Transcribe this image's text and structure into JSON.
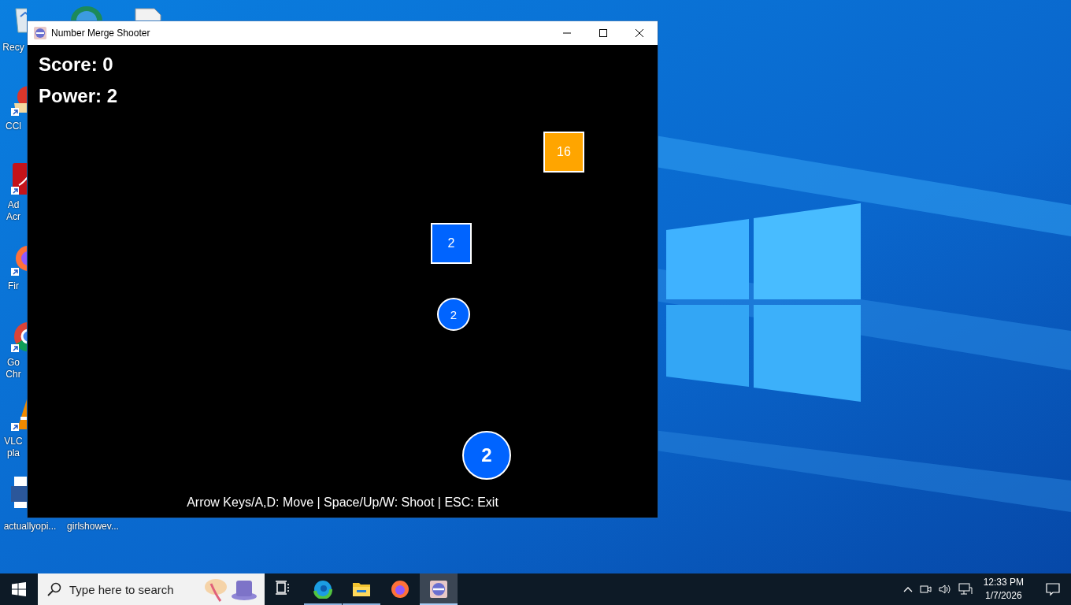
{
  "desktop_icons": [
    {
      "label": "Recy",
      "kind": "recycle"
    },
    {
      "label": "CCl",
      "kind": "broom"
    },
    {
      "label": "Ad Acr",
      "kind": "pdf"
    },
    {
      "label": "Fir",
      "kind": "firefox"
    },
    {
      "label": "Go Chr",
      "kind": "chrome"
    },
    {
      "label": "VLC pla",
      "kind": "cone"
    },
    {
      "label": "actuallyopi...",
      "kind": "word"
    },
    {
      "label": "girlshowev...",
      "kind": "hidden"
    }
  ],
  "window": {
    "title": "Number Merge Shooter",
    "hud": {
      "score": "Score: 0",
      "power": "Power: 2"
    },
    "blocks": [
      {
        "value": "16",
        "color": "#ffa500"
      },
      {
        "value": "2",
        "color": "#0064ff"
      }
    ],
    "bullets": [
      {
        "value": "2"
      }
    ],
    "player": {
      "value": "2"
    },
    "help": "Arrow Keys/A,D: Move | Space/Up/W: Shoot | ESC: Exit"
  },
  "taskbar": {
    "search": {
      "placeholder": "Type here to search"
    },
    "apps": [
      {
        "kind": "taskview",
        "running": false,
        "selected": false
      },
      {
        "kind": "edge",
        "running": true,
        "selected": false
      },
      {
        "kind": "folder",
        "running": true,
        "selected": false
      },
      {
        "kind": "firefox",
        "running": false,
        "selected": false
      },
      {
        "kind": "game",
        "running": true,
        "selected": true
      }
    ],
    "time": "12:33 PM",
    "date": "1/7/2026"
  }
}
